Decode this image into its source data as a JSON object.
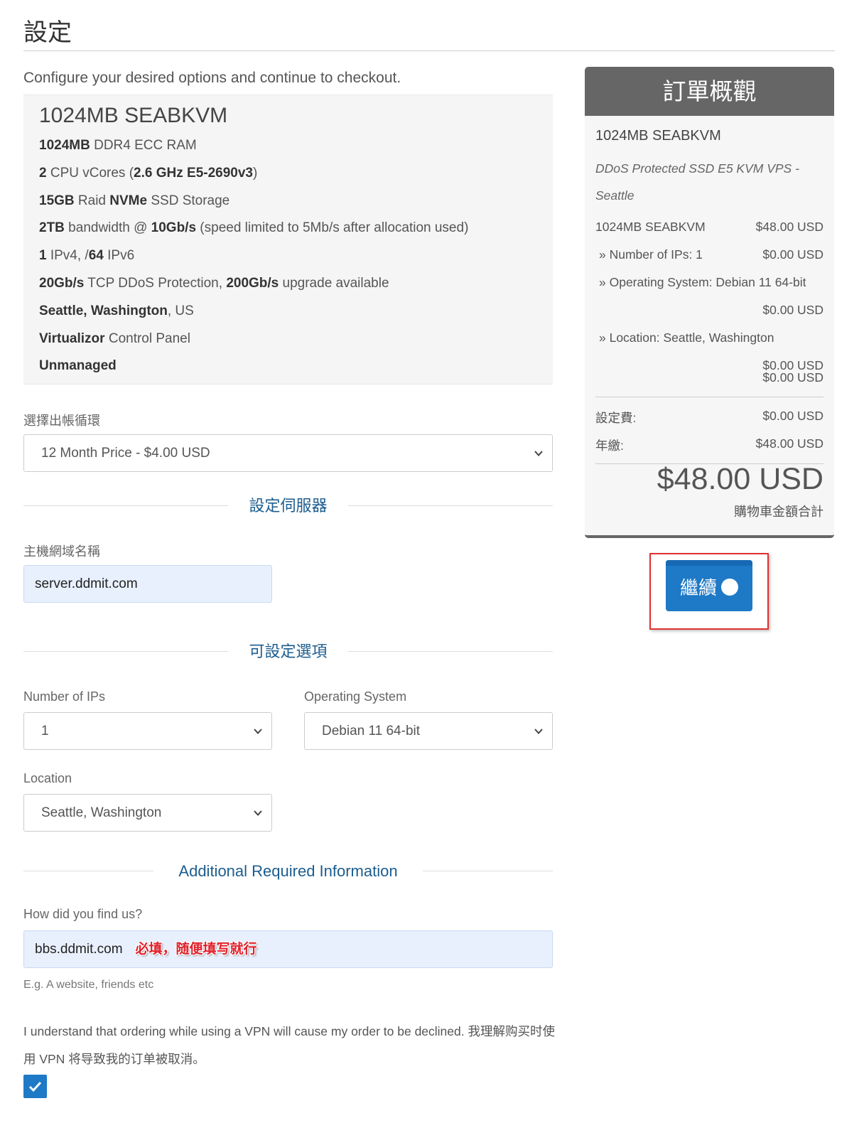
{
  "page": {
    "title": "設定",
    "intro": "Configure your desired options and continue to checkout."
  },
  "product": {
    "name": "1024MB SEABKVM",
    "features": [
      {
        "bold": "1024MB",
        "text": " DDR4 ECC RAM"
      },
      {
        "bold": "2",
        "text": " CPU vCores (",
        "bold2": "2.6 GHz E5-2690v3",
        "text2": ")"
      },
      {
        "bold": "15GB",
        "text": " Raid ",
        "bold2": "NVMe",
        "text2": " SSD Storage"
      },
      {
        "bold": "2TB",
        "text": " bandwidth @ ",
        "bold2": "10Gb/s",
        "text2": " (speed limited to 5Mb/s after allocation used)"
      },
      {
        "bold": "1",
        "text": " IPv4, /",
        "bold2": "64",
        "text2": " IPv6"
      },
      {
        "bold": "20Gb/s",
        "text": " TCP DDoS Protection, ",
        "bold2": "200Gb/s",
        "text2": " upgrade available"
      },
      {
        "bold": "Seattle, Washington",
        "text": ", US"
      },
      {
        "bold": "Virtualizor",
        "text": " Control Panel"
      },
      {
        "bold": "Unmanaged",
        "text": ""
      }
    ]
  },
  "billing": {
    "label": "選擇出帳循環",
    "selected": "12 Month Price - $4.00 USD"
  },
  "server_section": {
    "heading": "設定伺服器",
    "hostname_label": "主機網域名稱",
    "hostname_value": "server.ddmit.com"
  },
  "options_section": {
    "heading": "可設定選項",
    "ips_label": "Number of IPs",
    "ips_value": "1",
    "os_label": "Operating System",
    "os_value": "Debian 11 64-bit",
    "location_label": "Location",
    "location_value": "Seattle, Washington"
  },
  "additional_section": {
    "heading": "Additional Required Information",
    "find_label": "How did you find us?",
    "find_value": "bbs.ddmit.com",
    "annotation": "必填，随便填写就行",
    "help": "E.g. A website, friends etc",
    "vpn_text": "I understand that ordering while using a VPN will cause my order to be declined. 我理解购买时使用 VPN 将导致我的订单被取消。"
  },
  "summary": {
    "heading": "訂單概觀",
    "product": "1024MB SEABKVM",
    "group": "DDoS Protected SSD E5 KVM VPS - Seattle",
    "base_name": "1024MB SEABKVM",
    "base_price": "$48.00 USD",
    "opt_ips": "» Number of IPs: 1",
    "opt_ips_price": "$0.00 USD",
    "opt_os": "» Operating System: Debian 11 64-bit",
    "opt_os_price": "$0.00 USD",
    "opt_loc": "» Location: Seattle, Washington",
    "opt_loc_price": "$0.00 USD",
    "extra_price": "$0.00 USD",
    "setup_label": "設定費:",
    "setup_price": "$0.00 USD",
    "annual_label": "年繳:",
    "annual_price": "$48.00 USD",
    "total": "$48.00 USD",
    "total_label": "購物車金額合計"
  },
  "continue_button": {
    "label": "繼續",
    "icon": "circle-arrow-right-icon"
  },
  "colors": {
    "accent": "#1e79c6",
    "section_heading": "#1c5d8f",
    "summary_header": "#666666",
    "highlight_frame": "#e03030"
  }
}
